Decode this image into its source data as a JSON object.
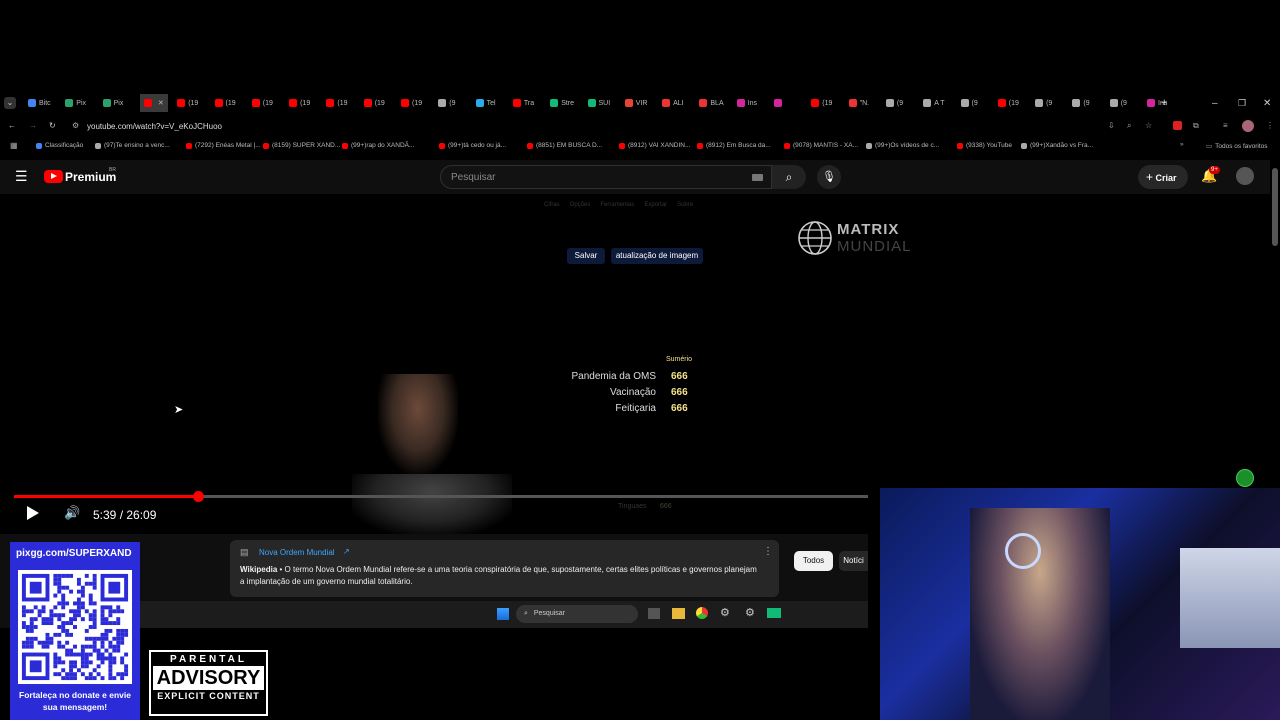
{
  "browser": {
    "tabs": [
      "Bitc",
      "Pix",
      "Pix",
      "",
      "(19",
      "(19",
      "(19",
      "(19",
      "(19",
      "(19",
      "(19",
      "(9",
      "Tel",
      "Tra",
      "Stre",
      "SUI",
      "VIR",
      "ALI",
      "BLA",
      "Ins",
      "",
      "(19",
      "\"N.",
      "(9",
      "A T",
      "(9",
      "(19",
      "(9",
      "(9",
      "(9",
      "Ins"
    ],
    "url": "youtube.com/watch?v=V_eKoJCHuoo",
    "bookmarks": [
      "Classificação",
      "(97)Te ensino a venc...",
      "(7292) Enéas Metal |...",
      "(8159) SUPER XAND...",
      "(99+)rap do XANDÃ...",
      "(99+)tá cedo ou já...",
      "(8851) EM BUSCA D...",
      "(8912) VAI XANDIN...",
      "(8912) Em Busca da...",
      "(9078) MANTIS - XA...",
      "(99+)Os vídeos de c...",
      "(9338) YouTube",
      "(99+)Xandão vs Fra..."
    ],
    "all_bookmarks": "Todos os favoritos"
  },
  "youtube": {
    "logo_text": "Premium",
    "logo_badge": "BR",
    "search_placeholder": "Pesquisar",
    "create_label": "Criar",
    "notif_count": "9+"
  },
  "video": {
    "menu_items": [
      "Cifras",
      "Opções",
      "Ferramentas",
      "Exportar",
      "Sobre"
    ],
    "save_btn": "Salvar",
    "update_btn": "atualização de imagem",
    "brand_line1": "MATRIX",
    "brand_line2": "MUNDIAL",
    "summary_title": "Sumério",
    "summary": [
      {
        "label": "Pandemia da OMS",
        "value": "666"
      },
      {
        "label": "Vacinação",
        "value": "666"
      },
      {
        "label": "Feitiçaria",
        "value": "666"
      }
    ],
    "faded_label": "Tinguaes",
    "faded_value": "666",
    "time": "5:39 / 26:09",
    "progress_fraction": 0.216
  },
  "info_panel": {
    "title": "Nova Ordem Mundial",
    "source": "Wikipedia",
    "text": " • O termo Nova Ordem Mundial refere-se a uma teoria conspiratória de que, supostamente, certas elites políticas e governos planejam a implantação de um governo mundial totalitário."
  },
  "chips": [
    "Todos",
    "Notíci"
  ],
  "taskbar": {
    "search": "Pesquisar"
  },
  "overlay": {
    "pix": "pixgg.com/SUPERXAND",
    "donate": "Fortaleça no donate e envie sua mensagem!",
    "parental": "PARENTAL",
    "advisory": "ADVISORY",
    "explicit": "EXPLICIT CONTENT"
  },
  "colors": {
    "accent": "#ff0000",
    "youtube_bg": "#0f0f0f",
    "gold": "#f5e08a",
    "link": "#3ea6ff"
  }
}
